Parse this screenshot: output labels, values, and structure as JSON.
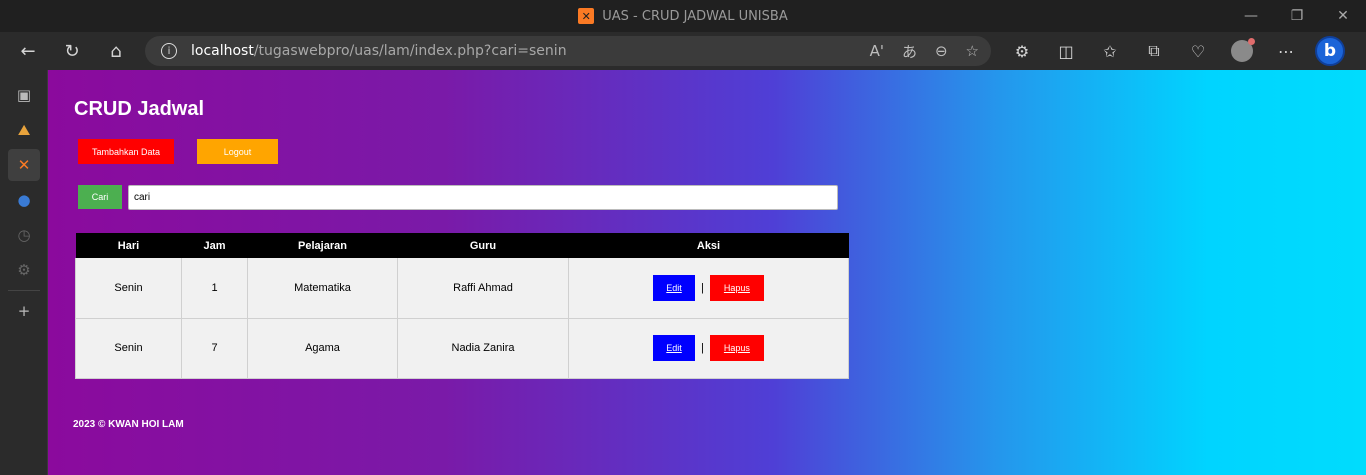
{
  "window": {
    "title": "UAS - CRUD JADWAL UNISBA",
    "controls": [
      "—",
      "❐",
      "✕"
    ]
  },
  "browser": {
    "url_host": "localhost",
    "url_path": "/tugaswebpro/uas/lam/index.php?cari=senin"
  },
  "page": {
    "title": "CRUD Jadwal",
    "add_button": "Tambahkan Data",
    "logout_button": "Logout",
    "search_button": "Cari",
    "search_value": "cari",
    "table": {
      "headers": [
        "Hari",
        "Jam",
        "Pelajaran",
        "Guru",
        "Aksi"
      ],
      "rows": [
        {
          "hari": "Senin",
          "jam": "1",
          "pelajaran": "Matematika",
          "guru": "Raffi Ahmad",
          "edit": "Edit",
          "hapus": "Hapus",
          "sep": "|"
        },
        {
          "hari": "Senin",
          "jam": "7",
          "pelajaran": "Agama",
          "guru": "Nadia Zanira",
          "edit": "Edit",
          "hapus": "Hapus",
          "sep": "|"
        }
      ]
    },
    "footer": "2023 © KWAN HOI LAM"
  },
  "colors": {
    "add_button": "#ff0000",
    "logout_button": "#ffa500",
    "search_button": "#4caf50",
    "edit_button": "#0000ff",
    "hapus_button": "#ff0000",
    "gradient_start": "#8b0a9d",
    "gradient_end": "#00dcfd"
  }
}
